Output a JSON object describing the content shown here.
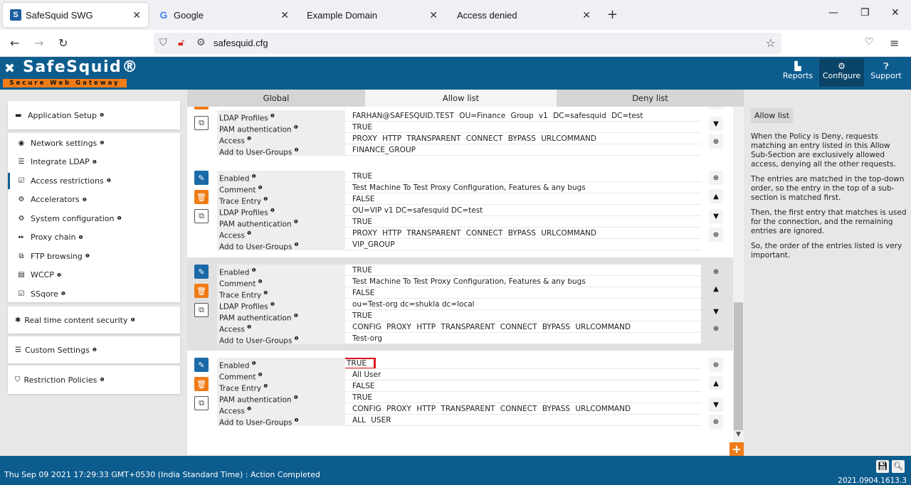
{
  "browser": {
    "tabs": [
      {
        "title": "SafeSquid SWG",
        "favicon": "S"
      },
      {
        "title": "Google",
        "favicon": "G"
      },
      {
        "title": "Example Domain"
      },
      {
        "title": "Access denied"
      }
    ],
    "url": "safesquid.cfg"
  },
  "app": {
    "brand": "SafeSquid®",
    "tagline": "Secure Web Gateway",
    "header_buttons": [
      {
        "label": "Reports",
        "icon": "chart-icon"
      },
      {
        "label": "Configure",
        "icon": "gears-icon"
      },
      {
        "label": "Support",
        "icon": "help-icon"
      }
    ]
  },
  "sidebar": {
    "app_setup": "Application Setup",
    "items": [
      "Network settings",
      "Integrate LDAP",
      "Access restrictions",
      "Accelerators",
      "System configuration",
      "Proxy chain",
      "FTP browsing",
      "WCCP",
      "SSqore"
    ],
    "rtcs": "Real time content security",
    "custom": "Custom Settings",
    "restriction": "Restriction Policies"
  },
  "tabs": [
    "Global",
    "Allow list",
    "Deny list"
  ],
  "entries": [
    {
      "rows": [
        {
          "label": "LDAP Profiles",
          "value": "FARHAN@SAFESQUID.TEST  OU=Finance Group v1 DC=safesquid DC=test"
        },
        {
          "label": "PAM authentication",
          "value": "TRUE"
        },
        {
          "label": "Access",
          "value": "PROXY HTTP TRANSPARENT CONNECT BYPASS URLCOMMAND"
        },
        {
          "label": "Add to User-Groups",
          "value": "FINANCE_GROUP"
        }
      ]
    },
    {
      "rows": [
        {
          "label": "Enabled",
          "value": "TRUE"
        },
        {
          "label": "Comment",
          "value": "Test Machine To Test Proxy Configuration, Features & any bugs"
        },
        {
          "label": "Trace Entry",
          "value": "FALSE"
        },
        {
          "label": "LDAP Profiles",
          "value": "OU=VIP v1 DC=safesquid DC=test"
        },
        {
          "label": "PAM authentication",
          "value": "TRUE"
        },
        {
          "label": "Access",
          "value": "PROXY HTTP TRANSPARENT CONNECT BYPASS URLCOMMAND"
        },
        {
          "label": "Add to User-Groups",
          "value": "VIP_GROUP"
        }
      ]
    },
    {
      "rows": [
        {
          "label": "Enabled",
          "value": "TRUE"
        },
        {
          "label": "Comment",
          "value": "Test Machine To Test Proxy Configuration, Features & any bugs"
        },
        {
          "label": "Trace Entry",
          "value": "FALSE"
        },
        {
          "label": "LDAP Profiles",
          "value": "ou=Test-org dc=shukla dc=local"
        },
        {
          "label": "PAM authentication",
          "value": "TRUE"
        },
        {
          "label": "Access",
          "value": "CONFIG PROXY HTTP TRANSPARENT CONNECT BYPASS URLCOMMAND"
        },
        {
          "label": "Add to User-Groups",
          "value": "Test-org"
        }
      ]
    },
    {
      "rows": [
        {
          "label": "Enabled",
          "value": "TRUE"
        },
        {
          "label": "Comment",
          "value": "All User"
        },
        {
          "label": "Trace Entry",
          "value": "FALSE"
        },
        {
          "label": "PAM authentication",
          "value": "TRUE"
        },
        {
          "label": "Access",
          "value": "CONFIG PROXY HTTP TRANSPARENT CONNECT BYPASS URLCOMMAND"
        },
        {
          "label": "Add to User-Groups",
          "value": "ALL USER"
        }
      ]
    }
  ],
  "help": {
    "title": "Allow list",
    "paragraphs": [
      "When the Policy is Deny, requests matching an entry listed in this Allow Sub-Section are exclusively allowed access, denying all the other requests.",
      "The entries are matched in the top-down order, so the entry in the top of a sub-section is matched first.",
      "Then, the first entry that matches is used for the connection, and the remaining entries are ignored.",
      "So, the order of the entries listed is very important."
    ]
  },
  "footer": {
    "status": "Thu Sep 09 2021 17:29:33 GMT+0530 (India Standard Time) : Action Completed",
    "version": "2021.0904.1613.3"
  },
  "colors": {
    "header": "#0d5c8e",
    "accent": "#f07c17",
    "highlight": "#e0141e"
  }
}
